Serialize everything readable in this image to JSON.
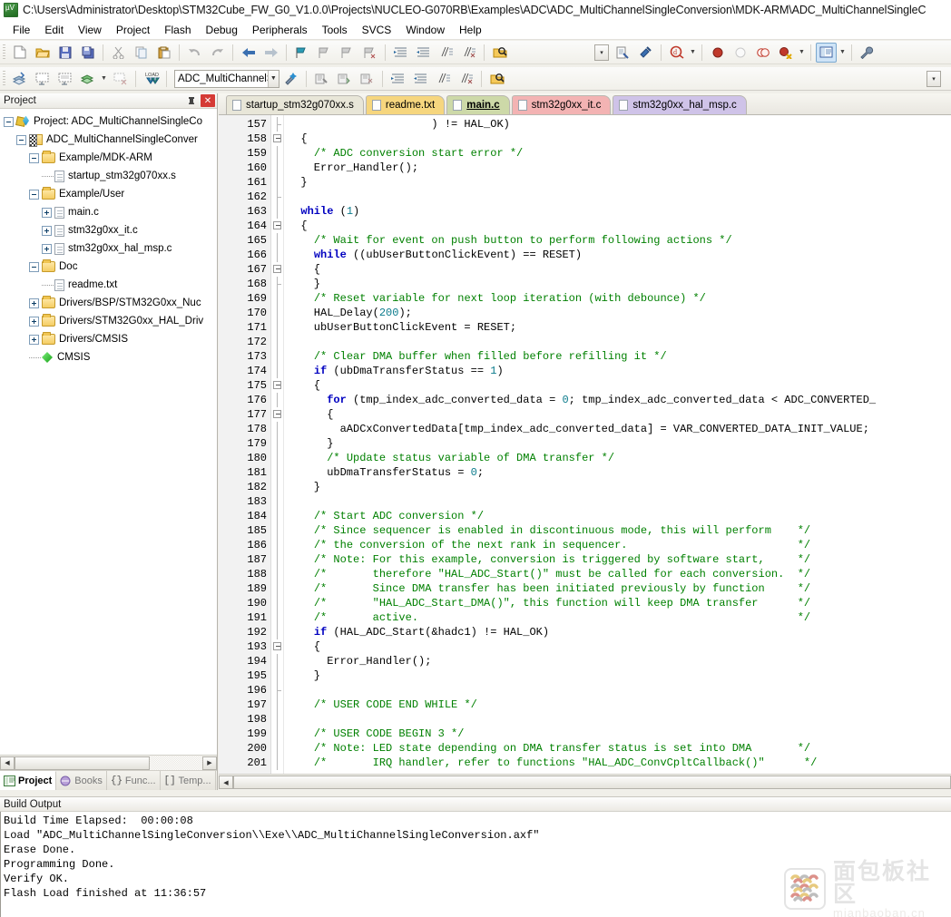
{
  "window": {
    "title": "C:\\Users\\Administrator\\Desktop\\STM32Cube_FW_G0_V1.0.0\\Projects\\NUCLEO-G070RB\\Examples\\ADC\\ADC_MultiChannelSingleConversion\\MDK-ARM\\ADC_MultiChannelSingleC",
    "app_icon": "uvision-icon"
  },
  "menu": {
    "items": [
      {
        "label": "File"
      },
      {
        "label": "Edit"
      },
      {
        "label": "View"
      },
      {
        "label": "Project"
      },
      {
        "label": "Flash"
      },
      {
        "label": "Debug"
      },
      {
        "label": "Peripherals"
      },
      {
        "label": "Tools"
      },
      {
        "label": "SVCS"
      },
      {
        "label": "Window"
      },
      {
        "label": "Help"
      }
    ]
  },
  "toolbar_main": {
    "buttons": [
      {
        "name": "new-file-icon",
        "glyph": "📄"
      },
      {
        "name": "open-file-icon",
        "glyph": "📂"
      },
      {
        "name": "save-icon",
        "glyph": "💾"
      },
      {
        "name": "save-all-icon",
        "glyph": "🖫"
      },
      {
        "name": "cut-icon",
        "glyph": "✂"
      },
      {
        "name": "copy-icon",
        "glyph": "❐"
      },
      {
        "name": "paste-icon",
        "glyph": "📋"
      },
      {
        "name": "undo-icon",
        "glyph": "↶"
      },
      {
        "name": "redo-icon",
        "glyph": "↷"
      },
      {
        "name": "navigate-backward-icon",
        "glyph": "←"
      },
      {
        "name": "navigate-forward-icon",
        "glyph": "→"
      },
      {
        "name": "bookmark-toggle-icon",
        "glyph": "⚑"
      },
      {
        "name": "bookmark-prev-icon",
        "glyph": "⚑"
      },
      {
        "name": "bookmark-next-icon",
        "glyph": "⚑"
      },
      {
        "name": "bookmark-clear-icon",
        "glyph": "⚑"
      },
      {
        "name": "indent-icon",
        "glyph": "≡"
      },
      {
        "name": "outdent-icon",
        "glyph": "≡"
      },
      {
        "name": "comment-icon",
        "glyph": "∕"
      },
      {
        "name": "uncomment-icon",
        "glyph": "∕"
      },
      {
        "name": "find-in-files-icon",
        "glyph": "🔎"
      }
    ],
    "right_buttons": [
      {
        "name": "options-target-icon",
        "glyph": "📜"
      },
      {
        "name": "manage-runtime-icon",
        "glyph": "⚒"
      },
      {
        "name": "start-debug-icon",
        "glyph": "Q"
      },
      {
        "name": "breakpoint-icon",
        "glyph": "●"
      },
      {
        "name": "disable-breakpoint-icon",
        "glyph": "○"
      },
      {
        "name": "disable-all-breakpoints-icon",
        "glyph": "◎"
      },
      {
        "name": "kill-all-breakpoints-icon",
        "glyph": "●"
      },
      {
        "name": "project-window-icon",
        "glyph": "▤"
      },
      {
        "name": "configure-icon",
        "glyph": "🔧"
      }
    ],
    "empty_combo_name": "run-to-line-combo"
  },
  "toolbar_build": {
    "buttons": [
      {
        "name": "translate-icon",
        "glyph": "◈"
      },
      {
        "name": "build-icon",
        "glyph": "▦"
      },
      {
        "name": "rebuild-icon",
        "glyph": "▦"
      },
      {
        "name": "batch-build-icon",
        "glyph": "◈"
      },
      {
        "name": "stop-build-icon",
        "glyph": "▦"
      },
      {
        "name": "download-load-icon",
        "glyph": "LOAD"
      }
    ],
    "target_combo": {
      "name": "target-selector",
      "value": "ADC_MultiChannelSingle",
      "arrow": "▾"
    },
    "after_buttons": [
      {
        "name": "target-options-icon",
        "glyph": "✨"
      },
      {
        "name": "manage-project-items-icon",
        "glyph": "▤"
      },
      {
        "name": "pack-installer-icon",
        "glyph": "▣"
      },
      {
        "name": "manage-run-env-icon",
        "glyph": "◆"
      },
      {
        "name": "select-software-packs-icon",
        "glyph": "◆"
      },
      {
        "name": "open-books-icon",
        "glyph": "◆"
      }
    ]
  },
  "project_panel": {
    "title": "Project",
    "pin_icon": "pin-icon",
    "close_icon": "close-icon",
    "tree": [
      {
        "label": "Project: ADC_MultiChannelSingleCo",
        "depth": 0,
        "icon": "project-icon",
        "expander": "minus"
      },
      {
        "label": "ADC_MultiChannelSingleConver",
        "depth": 1,
        "icon": "target-icon",
        "expander": "minus"
      },
      {
        "label": "Example/MDK-ARM",
        "depth": 2,
        "icon": "folder-icon",
        "expander": "minus"
      },
      {
        "label": "startup_stm32g070xx.s",
        "depth": 3,
        "icon": "file-icon",
        "expander": "none"
      },
      {
        "label": "Example/User",
        "depth": 2,
        "icon": "folder-icon",
        "expander": "minus"
      },
      {
        "label": "main.c",
        "depth": 3,
        "icon": "file-icon",
        "expander": "plus"
      },
      {
        "label": "stm32g0xx_it.c",
        "depth": 3,
        "icon": "file-icon",
        "expander": "plus"
      },
      {
        "label": "stm32g0xx_hal_msp.c",
        "depth": 3,
        "icon": "file-icon",
        "expander": "plus"
      },
      {
        "label": "Doc",
        "depth": 2,
        "icon": "folder-icon",
        "expander": "minus"
      },
      {
        "label": "readme.txt",
        "depth": 3,
        "icon": "file-icon",
        "expander": "none"
      },
      {
        "label": "Drivers/BSP/STM32G0xx_Nuc",
        "depth": 2,
        "icon": "folder-icon",
        "expander": "plus"
      },
      {
        "label": "Drivers/STM32G0xx_HAL_Driv",
        "depth": 2,
        "icon": "folder-icon",
        "expander": "plus"
      },
      {
        "label": "Drivers/CMSIS",
        "depth": 2,
        "icon": "folder-icon",
        "expander": "plus"
      },
      {
        "label": "CMSIS",
        "depth": 2,
        "icon": "cmsis-icon",
        "expander": "none"
      }
    ],
    "bottom_tabs": [
      {
        "label": "Project",
        "active": true,
        "icon": "project-window-icon"
      },
      {
        "label": "Books",
        "active": false,
        "icon": "books-icon"
      },
      {
        "label": "Func...",
        "active": false,
        "icon": "functions-icon"
      },
      {
        "label": "Temp...",
        "active": false,
        "icon": "templates-icon"
      }
    ]
  },
  "editor": {
    "tabs": [
      {
        "label": "startup_stm32g070xx.s",
        "color": "#e8e6d8",
        "active": false
      },
      {
        "label": "readme.txt",
        "color": "#f6d67e",
        "active": false
      },
      {
        "label": "main.c",
        "color": "#cdd9a8",
        "active": true
      },
      {
        "label": "stm32g0xx_it.c",
        "color": "#f3b3b3",
        "active": false
      },
      {
        "label": "stm32g0xx_hal_msp.c",
        "color": "#cfc3e8",
        "active": false
      }
    ],
    "first_line_number": 157,
    "lines": [
      {
        "n": 157,
        "fold": "dash",
        "tokens": [
          {
            "t": "                      ) != HAL_OK)",
            "c": "pl"
          }
        ]
      },
      {
        "n": 158,
        "fold": "box",
        "tokens": [
          {
            "t": "  {",
            "c": "pl"
          }
        ]
      },
      {
        "n": 159,
        "fold": "line",
        "tokens": [
          {
            "t": "    ",
            "c": "pl"
          },
          {
            "t": "/* ADC conversion start error */",
            "c": "cm"
          }
        ]
      },
      {
        "n": 160,
        "fold": "line",
        "tokens": [
          {
            "t": "    Error_Handler();",
            "c": "pl"
          }
        ]
      },
      {
        "n": 161,
        "fold": "line",
        "tokens": [
          {
            "t": "  }",
            "c": "pl"
          }
        ]
      },
      {
        "n": 162,
        "fold": "dash",
        "tokens": [
          {
            "t": "",
            "c": "pl"
          }
        ]
      },
      {
        "n": 163,
        "fold": "line",
        "tokens": [
          {
            "t": "  ",
            "c": "pl"
          },
          {
            "t": "while",
            "c": "kw"
          },
          {
            "t": " (",
            "c": "pl"
          },
          {
            "t": "1",
            "c": "num"
          },
          {
            "t": ")",
            "c": "pl"
          }
        ]
      },
      {
        "n": 164,
        "fold": "box",
        "tokens": [
          {
            "t": "  {",
            "c": "pl"
          }
        ]
      },
      {
        "n": 165,
        "fold": "line",
        "tokens": [
          {
            "t": "    ",
            "c": "pl"
          },
          {
            "t": "/* Wait for event on push button to perform following actions */",
            "c": "cm"
          }
        ]
      },
      {
        "n": 166,
        "fold": "line",
        "tokens": [
          {
            "t": "    ",
            "c": "pl"
          },
          {
            "t": "while",
            "c": "kw"
          },
          {
            "t": " ((ubUserButtonClickEvent) == RESET)",
            "c": "pl"
          }
        ]
      },
      {
        "n": 167,
        "fold": "box",
        "tokens": [
          {
            "t": "    {",
            "c": "pl"
          }
        ]
      },
      {
        "n": 168,
        "fold": "dash",
        "tokens": [
          {
            "t": "    }",
            "c": "pl"
          }
        ]
      },
      {
        "n": 169,
        "fold": "line",
        "tokens": [
          {
            "t": "    ",
            "c": "pl"
          },
          {
            "t": "/* Reset variable for next loop iteration (with debounce) */",
            "c": "cm"
          }
        ]
      },
      {
        "n": 170,
        "fold": "line",
        "tokens": [
          {
            "t": "    HAL_Delay(",
            "c": "pl"
          },
          {
            "t": "200",
            "c": "num"
          },
          {
            "t": ");",
            "c": "pl"
          }
        ]
      },
      {
        "n": 171,
        "fold": "line",
        "tokens": [
          {
            "t": "    ubUserButtonClickEvent = RESET;",
            "c": "pl"
          }
        ]
      },
      {
        "n": 172,
        "fold": "line",
        "tokens": [
          {
            "t": "",
            "c": "pl"
          }
        ]
      },
      {
        "n": 173,
        "fold": "line",
        "tokens": [
          {
            "t": "    ",
            "c": "pl"
          },
          {
            "t": "/* Clear DMA buffer when filled before refilling it */",
            "c": "cm"
          }
        ]
      },
      {
        "n": 174,
        "fold": "line",
        "tokens": [
          {
            "t": "    ",
            "c": "pl"
          },
          {
            "t": "if",
            "c": "kw"
          },
          {
            "t": " (ubDmaTransferStatus == ",
            "c": "pl"
          },
          {
            "t": "1",
            "c": "num"
          },
          {
            "t": ")",
            "c": "pl"
          }
        ]
      },
      {
        "n": 175,
        "fold": "box",
        "tokens": [
          {
            "t": "    {",
            "c": "pl"
          }
        ]
      },
      {
        "n": 176,
        "fold": "line",
        "tokens": [
          {
            "t": "      ",
            "c": "pl"
          },
          {
            "t": "for",
            "c": "kw"
          },
          {
            "t": " (tmp_index_adc_converted_data = ",
            "c": "pl"
          },
          {
            "t": "0",
            "c": "num"
          },
          {
            "t": "; tmp_index_adc_converted_data < ADC_CONVERTED_",
            "c": "pl"
          }
        ]
      },
      {
        "n": 177,
        "fold": "box",
        "tokens": [
          {
            "t": "      {",
            "c": "pl"
          }
        ]
      },
      {
        "n": 178,
        "fold": "line",
        "tokens": [
          {
            "t": "        aADCxConvertedData[tmp_index_adc_converted_data] = VAR_CONVERTED_DATA_INIT_VALUE;",
            "c": "pl"
          }
        ]
      },
      {
        "n": 179,
        "fold": "line",
        "tokens": [
          {
            "t": "      }",
            "c": "pl"
          }
        ]
      },
      {
        "n": 180,
        "fold": "line",
        "tokens": [
          {
            "t": "      ",
            "c": "pl"
          },
          {
            "t": "/* Update status variable of DMA transfer */",
            "c": "cm"
          }
        ]
      },
      {
        "n": 181,
        "fold": "line",
        "tokens": [
          {
            "t": "      ubDmaTransferStatus = ",
            "c": "pl"
          },
          {
            "t": "0",
            "c": "num"
          },
          {
            "t": ";",
            "c": "pl"
          }
        ]
      },
      {
        "n": 182,
        "fold": "line",
        "tokens": [
          {
            "t": "    }",
            "c": "pl"
          }
        ]
      },
      {
        "n": 183,
        "fold": "line",
        "tokens": [
          {
            "t": "",
            "c": "pl"
          }
        ]
      },
      {
        "n": 184,
        "fold": "line",
        "tokens": [
          {
            "t": "    ",
            "c": "pl"
          },
          {
            "t": "/* Start ADC conversion */",
            "c": "cm"
          }
        ]
      },
      {
        "n": 185,
        "fold": "line",
        "tokens": [
          {
            "t": "    ",
            "c": "pl"
          },
          {
            "t": "/* Since sequencer is enabled in discontinuous mode, this will perform    */",
            "c": "cm"
          }
        ]
      },
      {
        "n": 186,
        "fold": "line",
        "tokens": [
          {
            "t": "    ",
            "c": "pl"
          },
          {
            "t": "/* the conversion of the next rank in sequencer.                          */",
            "c": "cm"
          }
        ]
      },
      {
        "n": 187,
        "fold": "line",
        "tokens": [
          {
            "t": "    ",
            "c": "pl"
          },
          {
            "t": "/* Note: For this example, conversion is triggered by software start,     */",
            "c": "cm"
          }
        ]
      },
      {
        "n": 188,
        "fold": "line",
        "tokens": [
          {
            "t": "    ",
            "c": "pl"
          },
          {
            "t": "/*       therefore \"HAL_ADC_Start()\" must be called for each conversion.  */",
            "c": "cm"
          }
        ]
      },
      {
        "n": 189,
        "fold": "line",
        "tokens": [
          {
            "t": "    ",
            "c": "pl"
          },
          {
            "t": "/*       Since DMA transfer has been initiated previously by function     */",
            "c": "cm"
          }
        ]
      },
      {
        "n": 190,
        "fold": "line",
        "tokens": [
          {
            "t": "    ",
            "c": "pl"
          },
          {
            "t": "/*       \"HAL_ADC_Start_DMA()\", this function will keep DMA transfer      */",
            "c": "cm"
          }
        ]
      },
      {
        "n": 191,
        "fold": "line",
        "tokens": [
          {
            "t": "    ",
            "c": "pl"
          },
          {
            "t": "/*       active.                                                          */",
            "c": "cm"
          }
        ]
      },
      {
        "n": 192,
        "fold": "line",
        "tokens": [
          {
            "t": "    ",
            "c": "pl"
          },
          {
            "t": "if",
            "c": "kw"
          },
          {
            "t": " (HAL_ADC_Start(&hadc1) != HAL_OK)",
            "c": "pl"
          }
        ]
      },
      {
        "n": 193,
        "fold": "box",
        "tokens": [
          {
            "t": "    {",
            "c": "pl"
          }
        ]
      },
      {
        "n": 194,
        "fold": "line",
        "tokens": [
          {
            "t": "      Error_Handler();",
            "c": "pl"
          }
        ]
      },
      {
        "n": 195,
        "fold": "line",
        "tokens": [
          {
            "t": "    }",
            "c": "pl"
          }
        ]
      },
      {
        "n": 196,
        "fold": "dash",
        "tokens": [
          {
            "t": "",
            "c": "pl"
          }
        ]
      },
      {
        "n": 197,
        "fold": "line",
        "tokens": [
          {
            "t": "    ",
            "c": "pl"
          },
          {
            "t": "/* USER CODE END WHILE */",
            "c": "cm"
          }
        ]
      },
      {
        "n": 198,
        "fold": "line",
        "tokens": [
          {
            "t": "",
            "c": "pl"
          }
        ]
      },
      {
        "n": 199,
        "fold": "line",
        "tokens": [
          {
            "t": "    ",
            "c": "pl"
          },
          {
            "t": "/* USER CODE BEGIN 3 */",
            "c": "cm"
          }
        ]
      },
      {
        "n": 200,
        "fold": "line",
        "tokens": [
          {
            "t": "    ",
            "c": "pl"
          },
          {
            "t": "/* Note: LED state depending on DMA transfer status is set into DMA       */",
            "c": "cm"
          }
        ]
      },
      {
        "n": 201,
        "fold": "line",
        "tokens": [
          {
            "t": "    ",
            "c": "pl"
          },
          {
            "t": "/*       IRQ handler, refer to functions \"HAL_ADC_ConvCpltCallback()\"      */",
            "c": "cm"
          }
        ]
      }
    ]
  },
  "build_output": {
    "title": "Build Output",
    "lines": [
      "Build Time Elapsed:  00:00:08",
      "Load \"ADC_MultiChannelSingleConversion\\\\Exe\\\\ADC_MultiChannelSingleConversion.axf\"",
      "Erase Done.",
      "Programming Done.",
      "Verify OK.",
      "Flash Load finished at 11:36:57"
    ]
  },
  "watermark": {
    "cn": "面包板社区",
    "en": "mianbaoban.cn"
  },
  "colors": {
    "comment": "#008000",
    "keyword": "#0000c0",
    "number": "#0b7b8c",
    "plain": "#000000",
    "panel_border": "#b6b4ad"
  }
}
